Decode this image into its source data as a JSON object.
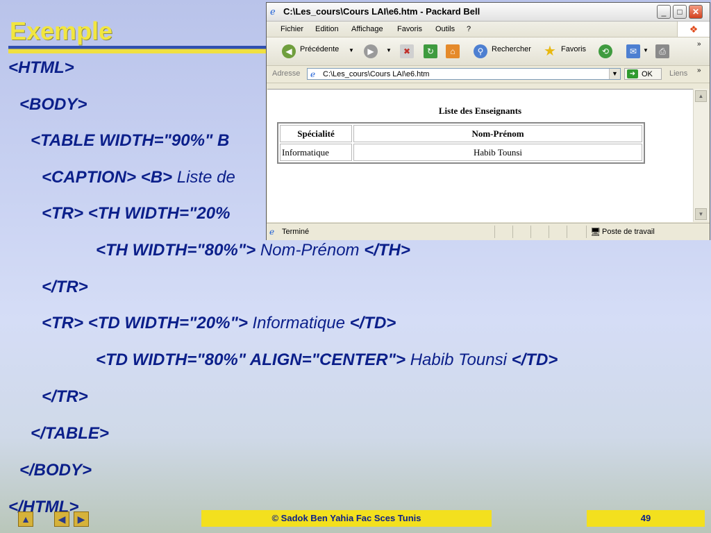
{
  "slide": {
    "title": "Exemple",
    "code": {
      "l1": "<HTML>",
      "l2": "<BODY>",
      "l3": "<TABLE WIDTH=\"90%\" B",
      "l4a": "<CAPTION> <B>",
      "l4b": "Liste de",
      "l5": "<TR> <TH WIDTH=\"20%",
      "l6a": "<TH WIDTH=\"80%\">",
      "l6b": "Nom-Prénom",
      "l6c": "</TH>",
      "l7": "</TR>",
      "l8a": "<TR> <TD WIDTH=\"20%\">",
      "l8b": "Informatique",
      "l8c": "</TD>",
      "l9a": "<TD WIDTH=\"80%\" ALIGN=\"CENTER\">",
      "l9b": "Habib Tounsi",
      "l9c": "</TD>",
      "l10": "</TR>",
      "l11": "</TABLE>",
      "l12": "</BODY>",
      "l13": "</HTML>"
    },
    "footer": {
      "copyright": "© Sadok Ben Yahia Fac Sces Tunis",
      "page": "49"
    }
  },
  "window": {
    "title": "C:\\Les_cours\\Cours LAI\\e6.htm - Packard Bell",
    "menu": [
      "Fichier",
      "Edition",
      "Affichage",
      "Favoris",
      "Outils",
      "?"
    ],
    "toolbar": {
      "back": "Précédente",
      "search": "Rechercher",
      "favorites": "Favoris"
    },
    "address": {
      "label": "Adresse",
      "value": "C:\\Les_cours\\Cours LAI\\e6.htm",
      "go": "OK",
      "links": "Liens"
    },
    "page": {
      "caption": "Liste des Enseignants",
      "headers": [
        "Spécialité",
        "Nom-Prénom"
      ],
      "rows": [
        [
          "Informatique",
          "Habib Tounsi"
        ]
      ]
    },
    "status": {
      "text": "Terminé",
      "zone": "Poste de travail"
    }
  }
}
